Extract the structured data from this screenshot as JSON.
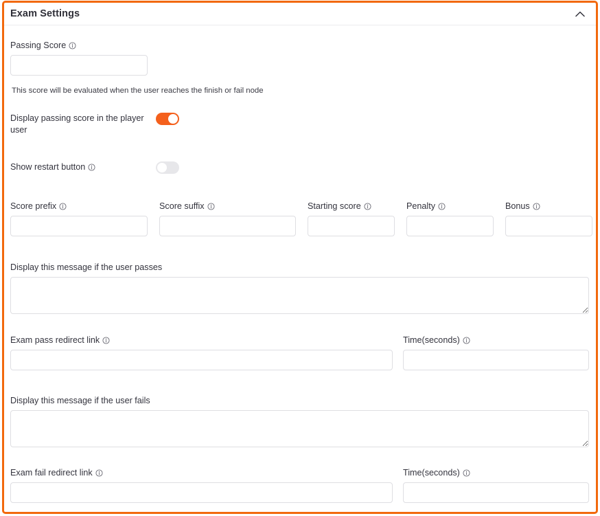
{
  "panel": {
    "title": "Exam Settings",
    "collapse_icon": "chevron-up-icon",
    "accent_color": "#f2690d",
    "border_color": "#dedee2"
  },
  "info_icon_name": "info-icon",
  "fields": {
    "passing_score": {
      "label": "Passing Score",
      "has_info": true,
      "value": "",
      "placeholder": "",
      "helper": "This score will be evaluated when the user reaches the finish or fail node"
    },
    "display_passing_score": {
      "label": "Display passing score in the player user",
      "has_info": false,
      "state": "on",
      "state_color": "#f4601c"
    },
    "show_restart_button": {
      "label": "Show restart button",
      "has_info": true,
      "state": "off",
      "state_color": "#e7e7ea"
    },
    "score_prefix": {
      "label": "Score prefix",
      "has_info": true,
      "value": "",
      "placeholder": ""
    },
    "score_suffix": {
      "label": "Score suffix",
      "has_info": true,
      "value": "",
      "placeholder": ""
    },
    "starting_score": {
      "label": "Starting score",
      "has_info": true,
      "value": "",
      "placeholder": ""
    },
    "penalty": {
      "label": "Penalty",
      "has_info": true,
      "value": "",
      "placeholder": ""
    },
    "bonus": {
      "label": "Bonus",
      "has_info": true,
      "value": "",
      "placeholder": ""
    },
    "pass_message": {
      "label": "Display this message if the user passes",
      "has_info": false,
      "value": "",
      "placeholder": ""
    },
    "pass_redirect_link": {
      "label": "Exam pass redirect link",
      "has_info": true,
      "value": "",
      "placeholder": ""
    },
    "pass_redirect_time": {
      "label": "Time(seconds)",
      "has_info": true,
      "value": "",
      "placeholder": ""
    },
    "fail_message": {
      "label": "Display this message if the user fails",
      "has_info": false,
      "value": "",
      "placeholder": ""
    },
    "fail_redirect_link": {
      "label": "Exam fail redirect link",
      "has_info": true,
      "value": "",
      "placeholder": ""
    },
    "fail_redirect_time": {
      "label": "Time(seconds)",
      "has_info": true,
      "value": "",
      "placeholder": ""
    }
  }
}
